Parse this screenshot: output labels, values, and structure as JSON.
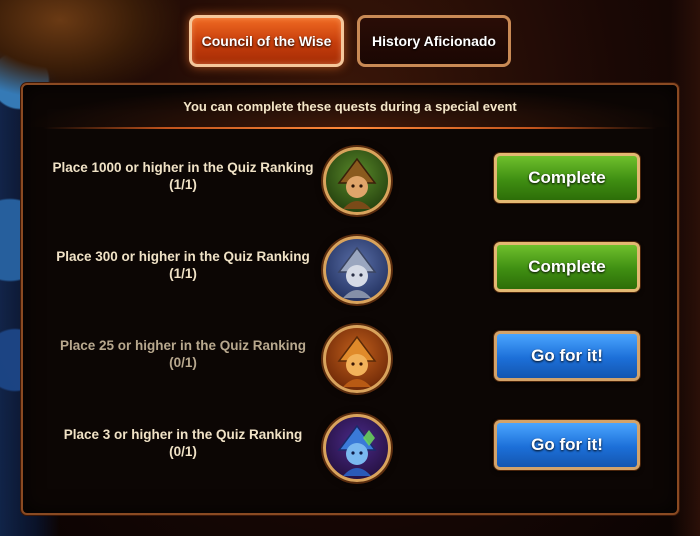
{
  "tabs": [
    {
      "label": "Council of the Wise",
      "active": true
    },
    {
      "label": "History Aficionado",
      "active": false
    }
  ],
  "panel": {
    "header": "You can complete these quests during a special event"
  },
  "quests": [
    {
      "title": "Place 1000 or higher in the Quiz Ranking",
      "progress": "(1/1)",
      "medal": "bronze-wizard-medal-icon",
      "button": "Complete",
      "status": "complete"
    },
    {
      "title": "Place 300 or higher in the Quiz Ranking",
      "progress": "(1/1)",
      "medal": "silver-wizard-medal-icon",
      "button": "Complete",
      "status": "complete"
    },
    {
      "title": "Place 25 or higher in the Quiz Ranking",
      "progress": "(0/1)",
      "medal": "gold-wizard-medal-icon",
      "button": "Go for it!",
      "status": "incomplete"
    },
    {
      "title": "Place 3 or higher in the Quiz Ranking",
      "progress": "(0/1)",
      "medal": "crystal-wizard-medal-icon",
      "button": "Go for it!",
      "status": "incomplete"
    }
  ],
  "colors": {
    "complete_button": "#3f8e12",
    "go_button": "#1c6fd8",
    "active_tab": "#c53c0b",
    "frame_gold": "#d9a35c"
  }
}
